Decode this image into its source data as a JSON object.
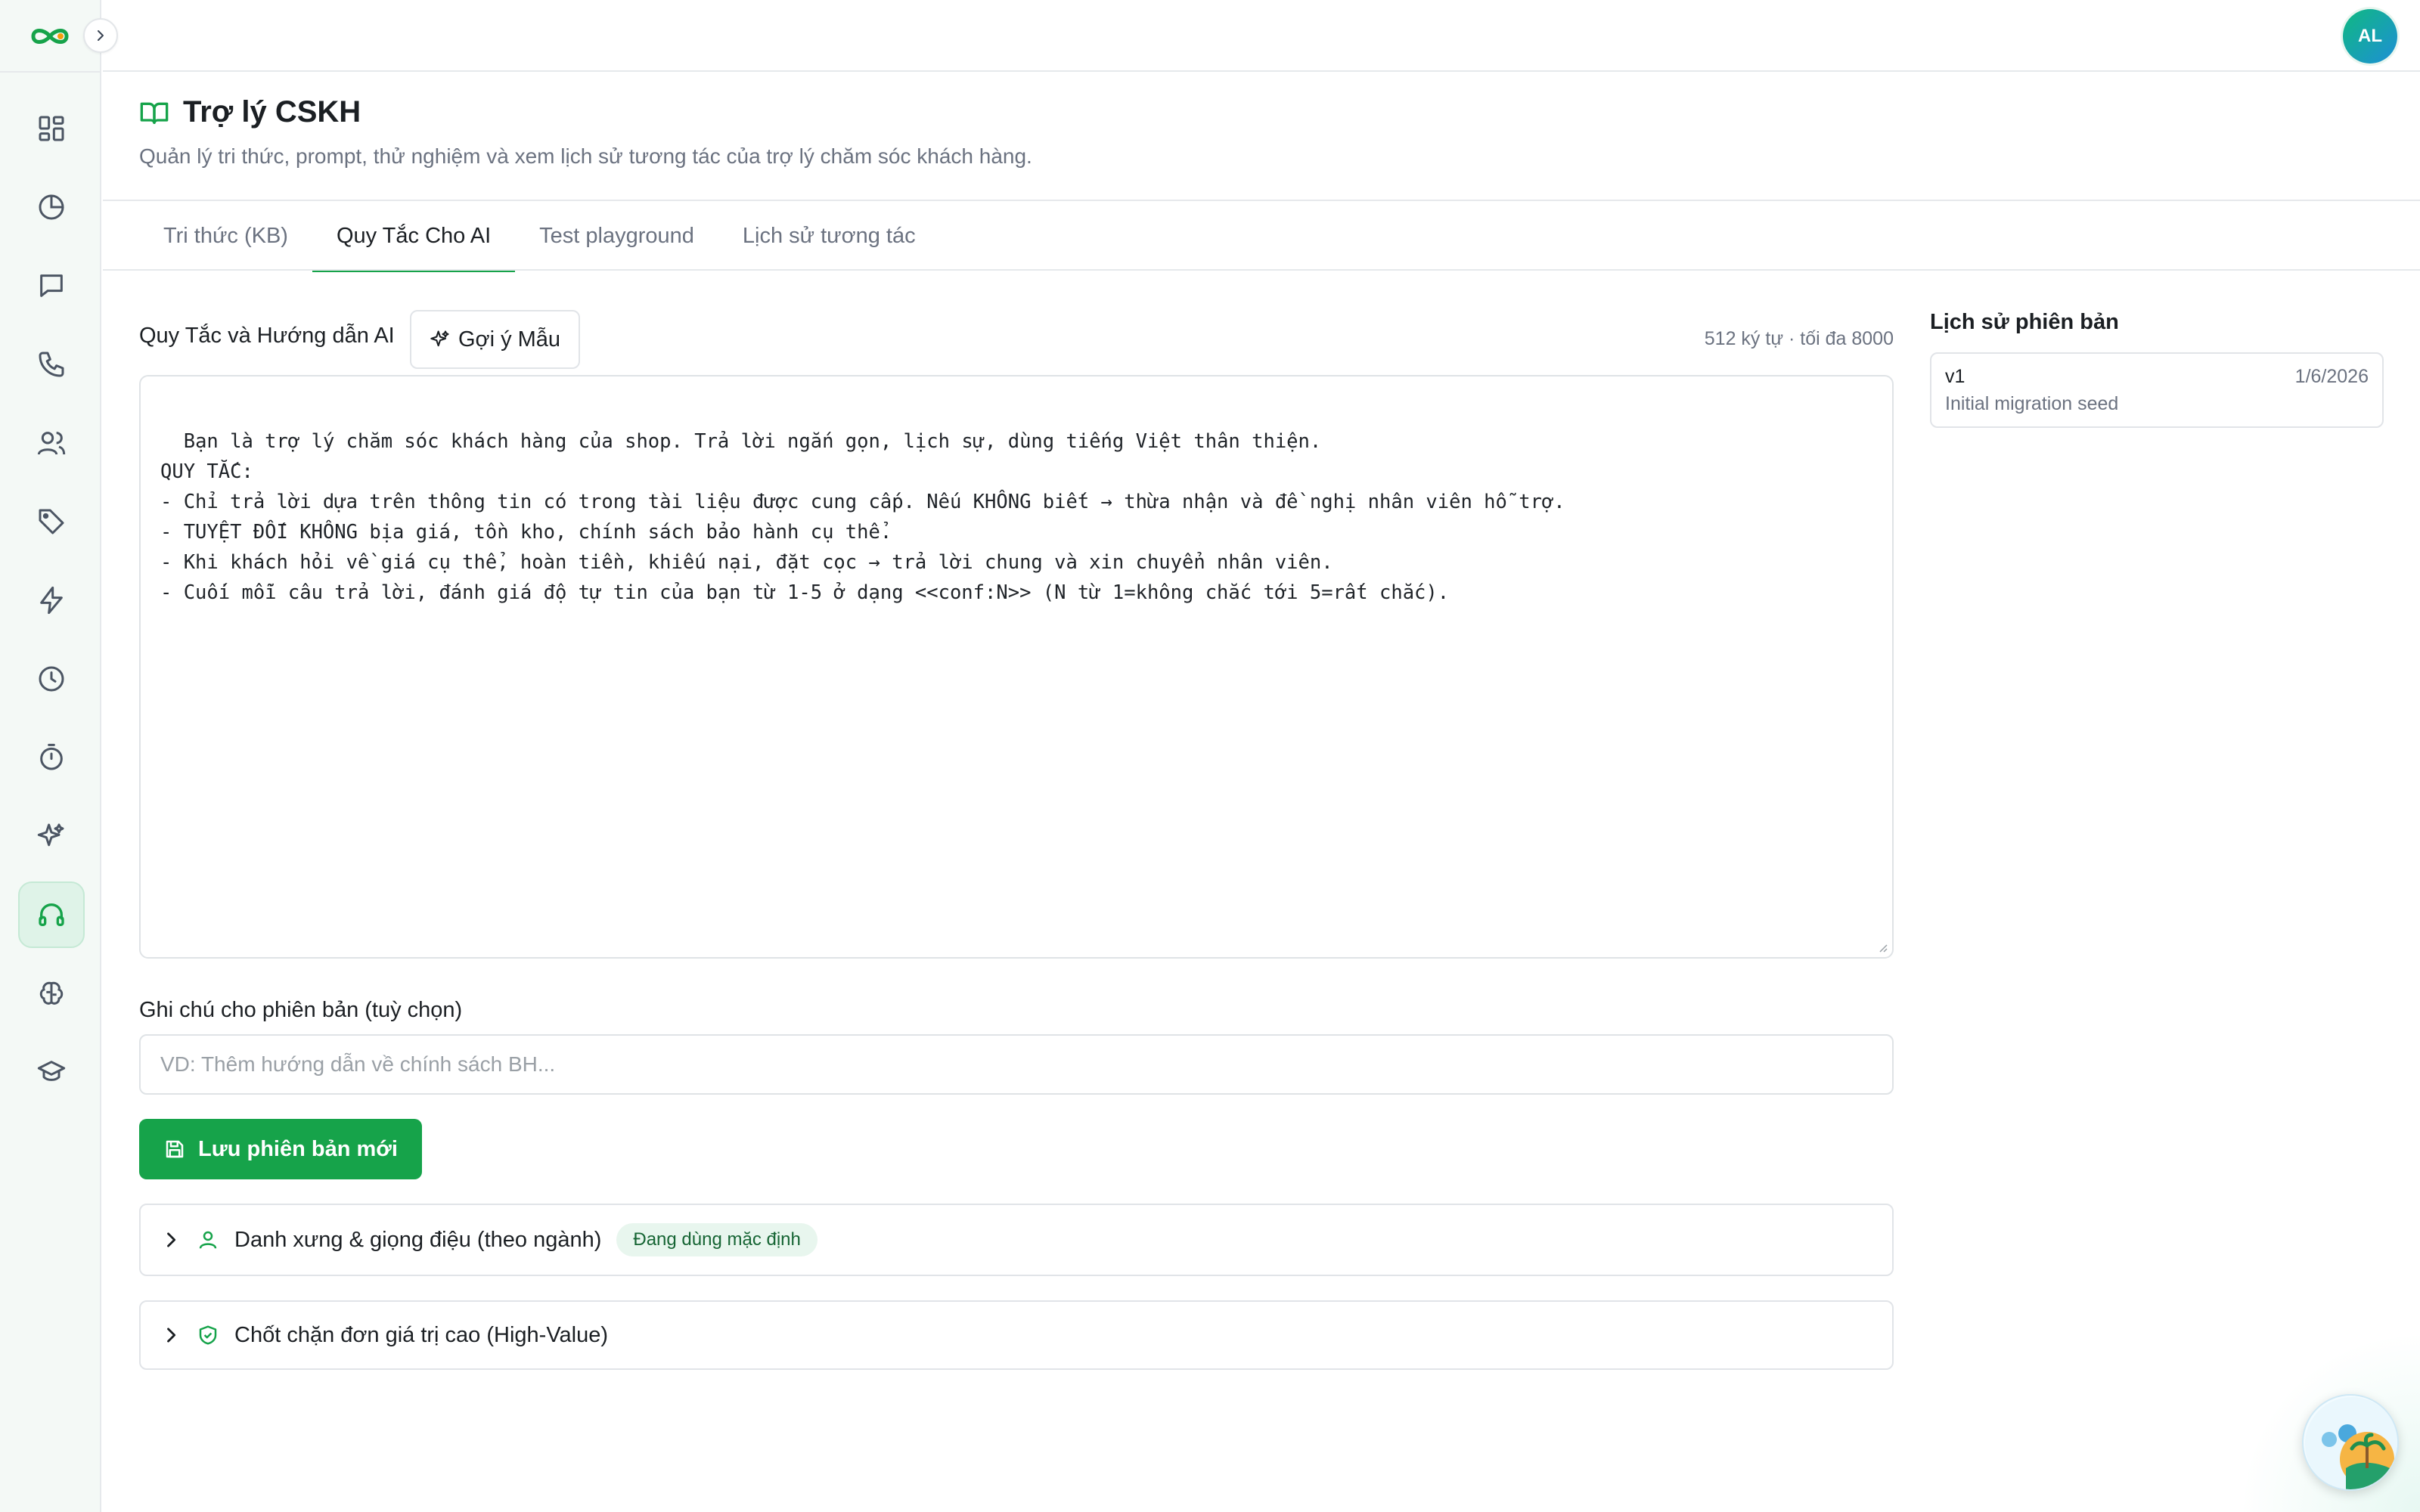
{
  "header": {
    "title": "Trợ lý CSKH",
    "subtitle": "Quản lý tri thức, prompt, thử nghiệm và xem lịch sử tương tác của trợ lý chăm sóc khách hàng."
  },
  "user": {
    "initials": "AL"
  },
  "sidebar": {
    "items": [
      {
        "name": "dashboard",
        "icon": "grid-icon"
      },
      {
        "name": "analytics",
        "icon": "pie-chart-icon"
      },
      {
        "name": "messages",
        "icon": "chat-icon"
      },
      {
        "name": "calls",
        "icon": "phone-icon"
      },
      {
        "name": "customers",
        "icon": "users-icon"
      },
      {
        "name": "tags",
        "icon": "tag-icon"
      },
      {
        "name": "automation",
        "icon": "lightning-icon"
      },
      {
        "name": "history",
        "icon": "clock-icon"
      },
      {
        "name": "timer",
        "icon": "stopwatch-icon"
      },
      {
        "name": "ai",
        "icon": "sparkle-icon"
      },
      {
        "name": "support-assistant",
        "icon": "headset-icon",
        "active": true
      },
      {
        "name": "brain",
        "icon": "brain-icon"
      },
      {
        "name": "training",
        "icon": "graduation-cap-icon"
      }
    ]
  },
  "tabs": [
    {
      "label": "Tri thức (KB)",
      "active": false
    },
    {
      "label": "Quy Tắc Cho AI",
      "active": true
    },
    {
      "label": "Test playground",
      "active": false
    },
    {
      "label": "Lịch sử tương tác",
      "active": false
    }
  ],
  "rules": {
    "label": "Quy Tắc và Hướng dẫn AI",
    "suggest_button": "Gợi ý Mẫu",
    "char_count": "512 ký tự · tối đa 8000",
    "prompt_text": "Bạn là trợ lý chăm sóc khách hàng của shop. Trả lời ngắn gọn, lịch sự, dùng tiếng Việt thân thiện.\nQUY TẮC:\n- Chỉ trả lời dựa trên thông tin có trong tài liệu được cung cấp. Nếu KHÔNG biết → thừa nhận và đề nghị nhân viên hỗ trợ.\n- TUYỆT ĐỐI KHÔNG bịa giá, tồn kho, chính sách bảo hành cụ thể.\n- Khi khách hỏi về giá cụ thể, hoàn tiền, khiếu nại, đặt cọc → trả lời chung và xin chuyển nhân viên.\n- Cuối mỗi câu trả lời, đánh giá độ tự tin của bạn từ 1-5 ở dạng <<conf:N>> (N từ 1=không chắc tới 5=rất chắc).",
    "note_label": "Ghi chú cho phiên bản (tuỳ chọn)",
    "note_placeholder": "VD: Thêm hướng dẫn về chính sách BH...",
    "note_value": "",
    "save_button": "Lưu phiên bản mới"
  },
  "accordions": [
    {
      "title": "Danh xưng & giọng điệu (theo ngành)",
      "badge": "Đang dùng mặc định",
      "icon": "user-icon"
    },
    {
      "title": "Chốt chặn đơn giá trị cao (High-Value)",
      "icon": "shield-check-icon"
    }
  ],
  "versions": {
    "title": "Lịch sử phiên bản",
    "items": [
      {
        "name": "v1",
        "date": "1/6/2026",
        "note": "Initial migration seed"
      }
    ]
  },
  "colors": {
    "accent": "#16a34a",
    "accent_light": "#e8f6ee",
    "text_muted": "#6b7280",
    "border": "#e1e4e8"
  }
}
